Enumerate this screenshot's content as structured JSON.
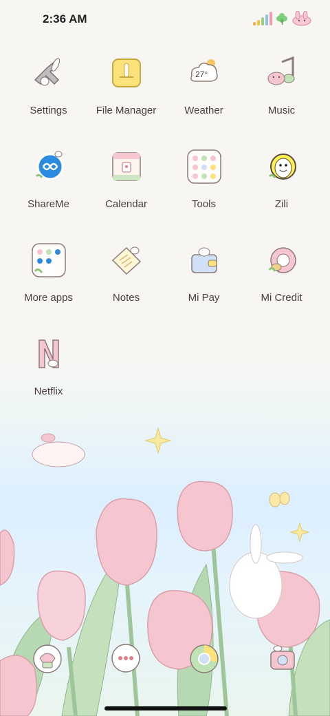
{
  "status_bar": {
    "time": "2:36 AM",
    "icons": [
      "signal-icon",
      "clover-icon",
      "bunny-icon"
    ]
  },
  "apps": [
    {
      "name": "Settings",
      "icon": "bunny-gear-icon"
    },
    {
      "name": "File Manager",
      "icon": "folder-icon"
    },
    {
      "name": "Weather",
      "icon": "weather-cloud-icon",
      "temp": "27°"
    },
    {
      "name": "Music",
      "icon": "music-note-icon"
    },
    {
      "name": "ShareMe",
      "icon": "shareme-icon"
    },
    {
      "name": "Calendar",
      "icon": "calendar-icon"
    },
    {
      "name": "Tools",
      "icon": "tools-folder-icon"
    },
    {
      "name": "Zili",
      "icon": "zili-icon"
    },
    {
      "name": "More apps",
      "icon": "more-apps-folder-icon"
    },
    {
      "name": "Notes",
      "icon": "notes-icon"
    },
    {
      "name": "Mi Pay",
      "icon": "wallet-icon"
    },
    {
      "name": "Mi Credit",
      "icon": "mi-credit-icon"
    },
    {
      "name": "Netflix",
      "icon": "netflix-icon"
    }
  ],
  "dock": [
    "phone-icon",
    "messages-icon",
    "browser-icon",
    "camera-icon"
  ],
  "colors": {
    "pink": "#f6c6d0",
    "yellow": "#fbe27a",
    "green": "#cfe6c2",
    "blue": "#2a8be0",
    "text": "#4a3f3a"
  }
}
